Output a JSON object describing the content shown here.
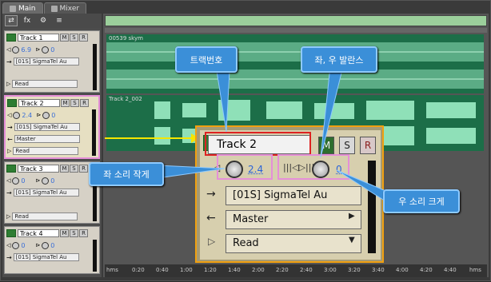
{
  "tabs": [
    {
      "label": "Main"
    },
    {
      "label": "Mixer"
    }
  ],
  "toolbar": {
    "fx_label": "fx"
  },
  "tracks": [
    {
      "name": "Track 1",
      "m": "M",
      "s": "S",
      "r": "R",
      "vol": "6.9",
      "pan": "0",
      "input": "[01S] SigmaTel Au",
      "mode": "Read"
    },
    {
      "name": "Track 2",
      "m": "M",
      "s": "S",
      "r": "R",
      "vol": "2.4",
      "pan": "0",
      "input": "[01S] SigmaTel Au",
      "output": "Master",
      "mode": "Read"
    },
    {
      "name": "Track 3",
      "m": "M",
      "s": "S",
      "r": "R",
      "vol": "0",
      "pan": "0",
      "input": "[01S] SigmaTel Au",
      "mode": "Read"
    },
    {
      "name": "Track 4",
      "m": "M",
      "s": "S",
      "r": "R",
      "vol": "0",
      "pan": "0",
      "input": "[01S] SigmaTel Au"
    }
  ],
  "clips": [
    {
      "label": "00539 skym"
    },
    {
      "label": "Track 2_002"
    }
  ],
  "ruler": {
    "unit": "hms",
    "ticks": [
      "0:20",
      "0:40",
      "1:00",
      "1:20",
      "1:40",
      "2:00",
      "2:20",
      "2:40",
      "3:00",
      "3:20",
      "3:40",
      "4:00",
      "4:20",
      "4:40",
      "hms"
    ]
  },
  "magnified": {
    "name": "Track 2",
    "m": "M",
    "s": "S",
    "r": "R",
    "vol": "2.4",
    "pan": "0",
    "input": "[01S] SigmaTel Au",
    "output": "Master",
    "mode": "Read"
  },
  "callouts": {
    "track_number": "트랙번호",
    "balance": "좌, 우 발란스",
    "left_low": "좌 소리 작게",
    "right_loud": "우 소리 크게"
  },
  "colors": {
    "wave": "#8fe0b8",
    "clip_bg": "#1c6e48",
    "callout": "#3b8fd8",
    "highlight_red": "#d22222",
    "highlight_pink": "#e58fd8",
    "mag_border": "#f0a010"
  }
}
